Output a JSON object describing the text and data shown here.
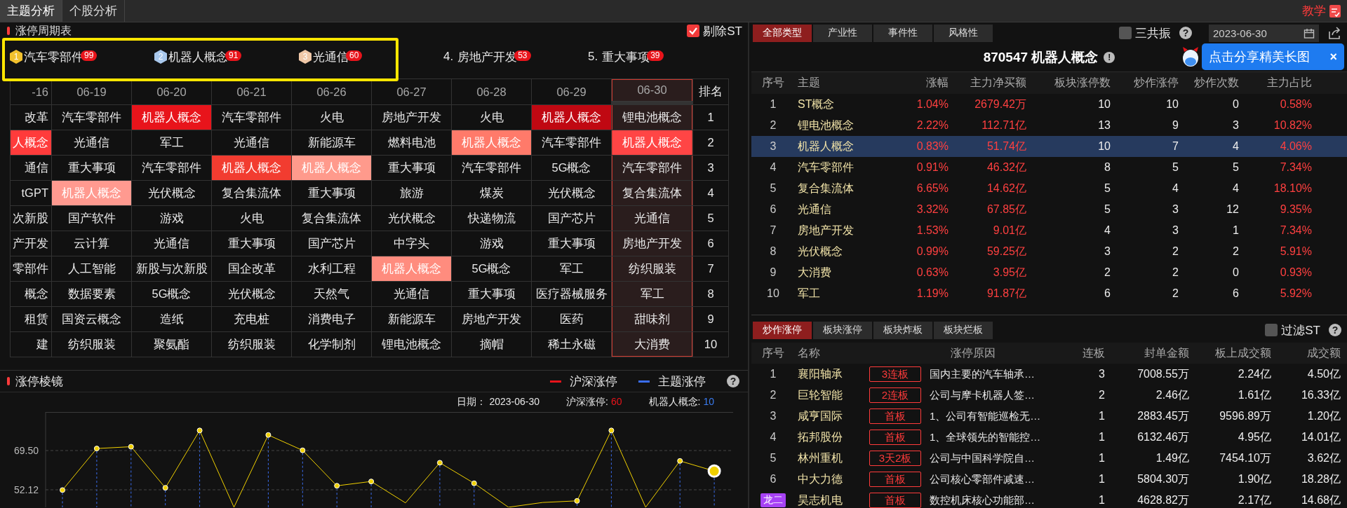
{
  "top_tabs": [
    {
      "label": "主题分析",
      "selected": true
    },
    {
      "label": "个股分析",
      "selected": false
    }
  ],
  "teaching": {
    "label": "教学"
  },
  "cycle_table": {
    "title": "涨停周期表",
    "exclude_st": {
      "label": "剔除ST",
      "checked": true
    },
    "top_themes": [
      {
        "kind": "medal",
        "rank": "1",
        "name": "汽车零部件",
        "count": "99"
      },
      {
        "kind": "medal",
        "rank": "2",
        "name": "机器人概念",
        "count": "91"
      },
      {
        "kind": "medal",
        "rank": "3",
        "name": "光通信",
        "count": "60"
      },
      {
        "kind": "plain",
        "rank": "4.",
        "name": "房地产开发",
        "count": "53"
      },
      {
        "kind": "plain",
        "rank": "5.",
        "name": "重大事项",
        "count": "39"
      }
    ],
    "columns": [
      {
        "label": "-16",
        "selected": false
      },
      {
        "label": "06-19",
        "selected": false
      },
      {
        "label": "06-20",
        "selected": false
      },
      {
        "label": "06-21",
        "selected": false
      },
      {
        "label": "06-26",
        "selected": false
      },
      {
        "label": "06-27",
        "selected": false
      },
      {
        "label": "06-28",
        "selected": false
      },
      {
        "label": "06-29",
        "selected": false
      },
      {
        "label": "06-30",
        "selected": true
      }
    ],
    "rank_header": "排名",
    "rows": [
      {
        "rank": "1",
        "cells": [
          {
            "text": "改革"
          },
          {
            "text": "汽车零部件"
          },
          {
            "text": "机器人概念",
            "color": "#e8141b"
          },
          {
            "text": "汽车零部件"
          },
          {
            "text": "火电"
          },
          {
            "text": "房地产开发"
          },
          {
            "text": "火电"
          },
          {
            "text": "机器人概念",
            "color": "#c00812"
          },
          {
            "text": "锂电池概念"
          }
        ]
      },
      {
        "rank": "2",
        "cells": [
          {
            "text": "人概念",
            "color": "#ff3b3b"
          },
          {
            "text": "光通信"
          },
          {
            "text": "军工"
          },
          {
            "text": "光通信"
          },
          {
            "text": "新能源车"
          },
          {
            "text": "燃料电池"
          },
          {
            "text": "机器人概念",
            "color": "#ff7a6a"
          },
          {
            "text": "汽车零部件"
          },
          {
            "text": "机器人概念",
            "color": "#ff4545"
          }
        ]
      },
      {
        "rank": "3",
        "cells": [
          {
            "text": "通信"
          },
          {
            "text": "重大事项"
          },
          {
            "text": "汽车零部件"
          },
          {
            "text": "机器人概念",
            "color": "#f23c30"
          },
          {
            "text": "机器人概念",
            "color": "#ff9a8c"
          },
          {
            "text": "重大事项"
          },
          {
            "text": "汽车零部件"
          },
          {
            "text": "5G概念"
          },
          {
            "text": "汽车零部件"
          }
        ]
      },
      {
        "rank": "4",
        "cells": [
          {
            "text": "tGPT"
          },
          {
            "text": "机器人概念",
            "color": "#ff9a90"
          },
          {
            "text": "光伏概念"
          },
          {
            "text": "复合集流体"
          },
          {
            "text": "重大事项"
          },
          {
            "text": "旅游"
          },
          {
            "text": "煤炭"
          },
          {
            "text": "光伏概念"
          },
          {
            "text": "复合集流体"
          }
        ]
      },
      {
        "rank": "5",
        "cells": [
          {
            "text": "次新股"
          },
          {
            "text": "国产软件"
          },
          {
            "text": "游戏"
          },
          {
            "text": "火电"
          },
          {
            "text": "复合集流体"
          },
          {
            "text": "光伏概念"
          },
          {
            "text": "快递物流"
          },
          {
            "text": "国产芯片"
          },
          {
            "text": "光通信"
          }
        ]
      },
      {
        "rank": "6",
        "cells": [
          {
            "text": "产开发"
          },
          {
            "text": "云计算"
          },
          {
            "text": "光通信"
          },
          {
            "text": "重大事项"
          },
          {
            "text": "国产芯片"
          },
          {
            "text": "中字头"
          },
          {
            "text": "游戏"
          },
          {
            "text": "重大事项"
          },
          {
            "text": "房地产开发"
          }
        ]
      },
      {
        "rank": "7",
        "cells": [
          {
            "text": "零部件"
          },
          {
            "text": "人工智能"
          },
          {
            "text": "新股与次新股"
          },
          {
            "text": "国企改革"
          },
          {
            "text": "水利工程"
          },
          {
            "text": "机器人概念",
            "color": "#ff8c7e"
          },
          {
            "text": "5G概念"
          },
          {
            "text": "军工"
          },
          {
            "text": "纺织服装"
          }
        ]
      },
      {
        "rank": "8",
        "cells": [
          {
            "text": "概念"
          },
          {
            "text": "数据要素"
          },
          {
            "text": "5G概念"
          },
          {
            "text": "光伏概念"
          },
          {
            "text": "天然气"
          },
          {
            "text": "光通信"
          },
          {
            "text": "重大事项"
          },
          {
            "text": "医疗器械服务"
          },
          {
            "text": "军工"
          }
        ]
      },
      {
        "rank": "9",
        "cells": [
          {
            "text": "租赁"
          },
          {
            "text": "国资云概念"
          },
          {
            "text": "造纸"
          },
          {
            "text": "充电桩"
          },
          {
            "text": "消费电子"
          },
          {
            "text": "新能源车"
          },
          {
            "text": "房地产开发"
          },
          {
            "text": "医药"
          },
          {
            "text": "甜味剂"
          }
        ]
      },
      {
        "rank": "10",
        "cells": [
          {
            "text": "建"
          },
          {
            "text": "纺织服装"
          },
          {
            "text": "聚氨酯"
          },
          {
            "text": "纺织服装"
          },
          {
            "text": "化学制剂"
          },
          {
            "text": "锂电池概念"
          },
          {
            "text": "摘帽"
          },
          {
            "text": "稀土永磁"
          },
          {
            "text": "大消费"
          }
        ]
      }
    ]
  },
  "prism": {
    "title": "涨停棱镜",
    "help": "?",
    "legend": [
      {
        "label": "沪深涨停",
        "color": "#e8141b"
      },
      {
        "label": "主题涨停",
        "color": "#3a6df0"
      }
    ],
    "info": [
      {
        "label": "日期：",
        "value": "2023-06-30",
        "color": "#e6e6e6"
      },
      {
        "label": "沪深涨停:",
        "value": "60",
        "color": "#e8141b"
      },
      {
        "label": "机器人概念:",
        "value": "10",
        "color": "#3a7bf0"
      }
    ],
    "chart_data": {
      "type": "line",
      "ylim": [
        44.36,
        86.57
      ],
      "grid": true,
      "yticks": [
        {
          "value": 52.12,
          "label": "52.12"
        },
        {
          "value": 69.5,
          "label": "69.50"
        }
      ],
      "series": [
        {
          "color": "#f0d000",
          "marker": "o",
          "values": [
            52,
            70.4,
            71.2,
            53,
            78.4,
            44.4,
            76.4,
            69.6,
            53.9,
            55.8,
            46.3,
            64.1,
            55,
            44.4,
            46.5,
            47.2,
            78.4,
            44.4,
            64.9,
            60.4
          ]
        }
      ]
    }
  },
  "theme_panel": {
    "type_tabs": [
      {
        "label": "全部类型",
        "selected": true
      },
      {
        "label": "产业性",
        "selected": false
      },
      {
        "label": "事件性",
        "selected": false
      },
      {
        "label": "风格性",
        "selected": false
      }
    ],
    "resonance": {
      "label": "三共振",
      "checked": false
    },
    "help": "?",
    "date": "2023-06-30",
    "tooltip": {
      "text": "点击分享精美长图",
      "close": "×"
    },
    "title": "870547 机器人概念",
    "title_icon": "!",
    "columns": [
      {
        "label": "序号",
        "kind": "index"
      },
      {
        "label": "主题",
        "kind": "name"
      },
      {
        "label": "涨幅",
        "kind": "rate"
      },
      {
        "label": "主力净买额",
        "kind": "rate"
      },
      {
        "label": "板块涨停数",
        "kind": "count"
      },
      {
        "label": "炒作涨停",
        "kind": "count"
      },
      {
        "label": "炒作次数",
        "kind": "count"
      },
      {
        "label": "主力占比",
        "kind": "rate"
      }
    ],
    "rows": [
      {
        "selected": false,
        "cells": [
          "1",
          "ST概念",
          "1.04%",
          "2679.42万",
          "10",
          "10",
          "0",
          "0.58%"
        ]
      },
      {
        "selected": false,
        "cells": [
          "2",
          "锂电池概念",
          "2.22%",
          "112.71亿",
          "13",
          "9",
          "3",
          "10.82%"
        ]
      },
      {
        "selected": true,
        "cells": [
          "3",
          "机器人概念",
          "0.83%",
          "51.74亿",
          "10",
          "7",
          "4",
          "4.06%"
        ]
      },
      {
        "selected": false,
        "cells": [
          "4",
          "汽车零部件",
          "0.91%",
          "46.32亿",
          "8",
          "5",
          "5",
          "7.34%"
        ]
      },
      {
        "selected": false,
        "cells": [
          "5",
          "复合集流体",
          "6.65%",
          "14.62亿",
          "5",
          "4",
          "4",
          "18.10%"
        ]
      },
      {
        "selected": false,
        "cells": [
          "6",
          "光通信",
          "3.32%",
          "67.85亿",
          "5",
          "3",
          "12",
          "9.35%"
        ]
      },
      {
        "selected": false,
        "cells": [
          "7",
          "房地产开发",
          "1.53%",
          "9.01亿",
          "4",
          "3",
          "1",
          "7.34%"
        ]
      },
      {
        "selected": false,
        "cells": [
          "8",
          "光伏概念",
          "0.99%",
          "59.25亿",
          "3",
          "2",
          "2",
          "5.91%"
        ]
      },
      {
        "selected": false,
        "cells": [
          "9",
          "大消费",
          "0.63%",
          "3.95亿",
          "2",
          "2",
          "0",
          "0.93%"
        ]
      },
      {
        "selected": false,
        "cells": [
          "10",
          "军工",
          "1.19%",
          "91.87亿",
          "6",
          "2",
          "6",
          "5.92%"
        ]
      }
    ]
  },
  "limit_panel": {
    "tabs": [
      {
        "label": "炒作涨停",
        "selected": true
      },
      {
        "label": "板块涨停",
        "selected": false
      },
      {
        "label": "板块炸板",
        "selected": false
      },
      {
        "label": "板块烂板",
        "selected": false
      }
    ],
    "filter_st": {
      "label": "过滤ST",
      "checked": false
    },
    "help": "?",
    "columns": [
      "序号",
      "名称",
      "涨停原因",
      "连板",
      "封单金额",
      "板上成交额",
      "成交额"
    ],
    "rows": [
      {
        "kind": "number",
        "rank": "1",
        "name": "襄阳轴承",
        "tag": "3连板",
        "reason": "国内主要的汽车轴承…",
        "streak": "3",
        "seal": "7008.55万",
        "board_volume": "2.24亿",
        "volume": "4.50亿"
      },
      {
        "kind": "number",
        "rank": "2",
        "name": "巨轮智能",
        "tag": "2连板",
        "reason": "公司与摩卡机器人签…",
        "streak": "2",
        "seal": "2.46亿",
        "board_volume": "1.61亿",
        "volume": "16.33亿"
      },
      {
        "kind": "number",
        "rank": "3",
        "name": "咸亨国际",
        "tag": "首板",
        "reason": "1、公司有智能巡检无…",
        "streak": "1",
        "seal": "2883.45万",
        "board_volume": "9596.89万",
        "volume": "1.20亿"
      },
      {
        "kind": "number",
        "rank": "4",
        "name": "拓邦股份",
        "tag": "首板",
        "reason": "1、全球领先的智能控…",
        "streak": "1",
        "seal": "6132.46万",
        "board_volume": "4.95亿",
        "volume": "14.01亿"
      },
      {
        "kind": "number",
        "rank": "5",
        "name": "林州重机",
        "tag": "3天2板",
        "reason": "公司与中国科学院自…",
        "streak": "1",
        "seal": "1.49亿",
        "board_volume": "7454.10万",
        "volume": "3.62亿"
      },
      {
        "kind": "number",
        "rank": "6",
        "name": "中大力德",
        "tag": "首板",
        "reason": "公司核心零部件减速…",
        "streak": "1",
        "seal": "5804.30万",
        "board_volume": "1.90亿",
        "volume": "18.28亿"
      },
      {
        "kind": "badge",
        "rank": "龙二",
        "name": "昊志机电",
        "tag": "首板",
        "reason": "数控机床核心功能部…",
        "streak": "1",
        "seal": "4628.82万",
        "board_volume": "2.17亿",
        "volume": "14.68亿"
      }
    ]
  }
}
